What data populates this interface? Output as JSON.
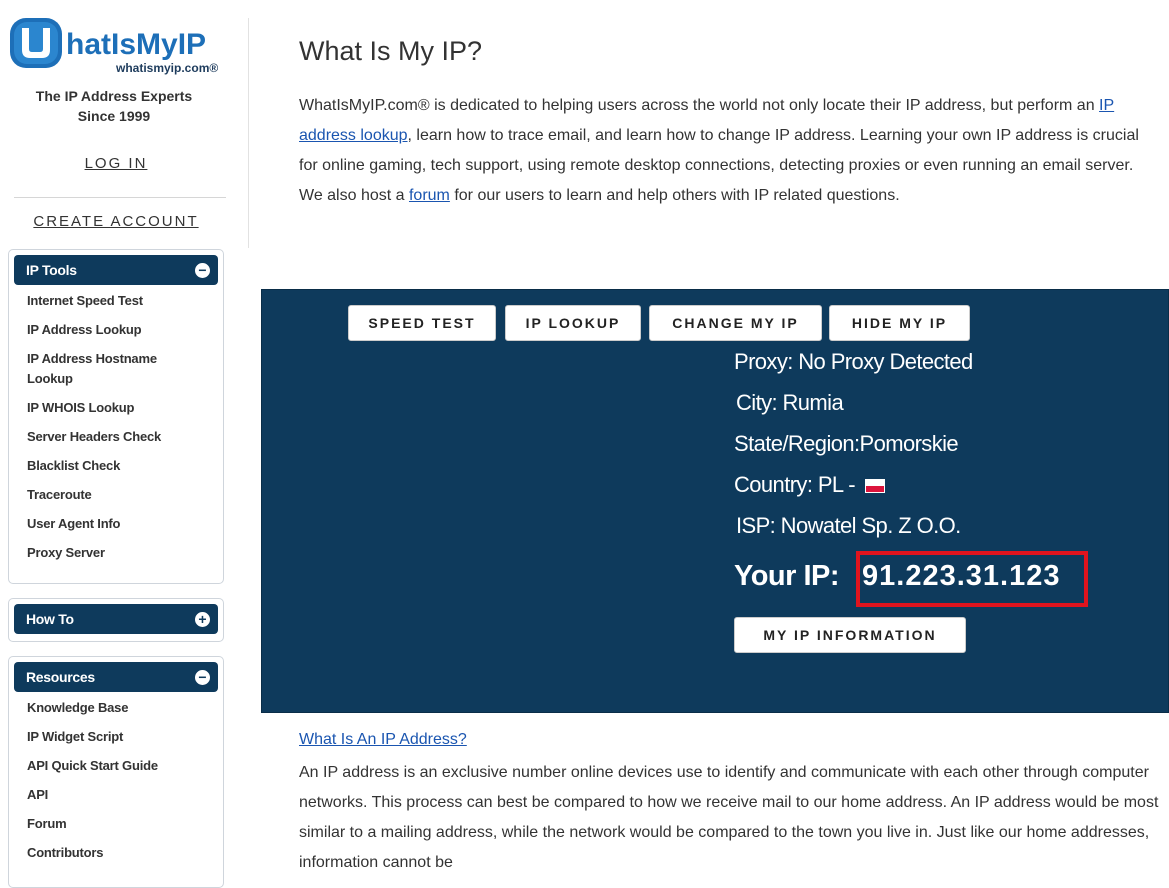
{
  "sidebar": {
    "logo": {
      "main": "hatIsMyIP",
      "sub": "whatismyip.com®"
    },
    "tagline1": "The IP Address Experts",
    "tagline2": "Since 1999",
    "login": "LOG IN",
    "create_account": "CREATE ACCOUNT",
    "panels": [
      {
        "title": "IP Tools",
        "toggle": "−",
        "items": [
          "Internet Speed Test",
          "IP Address Lookup",
          "IP Address Hostname Lookup",
          "IP WHOIS Lookup",
          "Server Headers Check",
          "Blacklist Check",
          "Traceroute",
          "User Agent Info",
          "Proxy Server"
        ]
      },
      {
        "title": "How To",
        "toggle": "+",
        "items": []
      },
      {
        "title": "Resources",
        "toggle": "−",
        "items": [
          "Knowledge Base",
          "IP Widget Script",
          "API Quick Start Guide",
          "API",
          "Forum",
          "Contributors"
        ]
      }
    ]
  },
  "main": {
    "title": "What Is My IP?",
    "intro": {
      "p1": "WhatIsMyIP.com® is dedicated to helping users across the world not only locate their IP address, but perform an ",
      "link1": "IP address lookup",
      "p2": ", learn how to trace email, and learn how to change IP address. Learning your own IP address is crucial for online gaming, tech support, using remote desktop connections, detecting proxies or even running an email server. We also host a ",
      "link2": "forum",
      "p3": " for our users to learn and help others with IP related questions."
    },
    "buttons": {
      "speed_test": "SPEED TEST",
      "ip_lookup": "IP LOOKUP",
      "change_ip": "CHANGE MY IP",
      "hide_ip": "HIDE MY IP",
      "ip_info": "MY IP INFORMATION"
    },
    "info": {
      "proxy": "Proxy:  No Proxy Detected",
      "city": "City:  Rumia",
      "state": "State/Region:Pomorskie",
      "country": "Country: PL - ",
      "isp": "ISP:  Nowatel Sp. Z O.O.",
      "your_ip_label": "Your IP:",
      "ip": "91.223.31.123"
    },
    "colors": {
      "panel_bg": "#0e3a5c",
      "highlight": "#e0141e",
      "link": "#1a55b0"
    },
    "lower": {
      "link": "What Is An IP Address?",
      "text": "An IP address is an exclusive number online devices use to identify and communicate with each other through computer networks. This process can best be compared to how we receive mail to our home address. An IP address would be most similar to a mailing address, while the network would be compared to the town you live in. Just like our home addresses, information cannot be"
    }
  }
}
